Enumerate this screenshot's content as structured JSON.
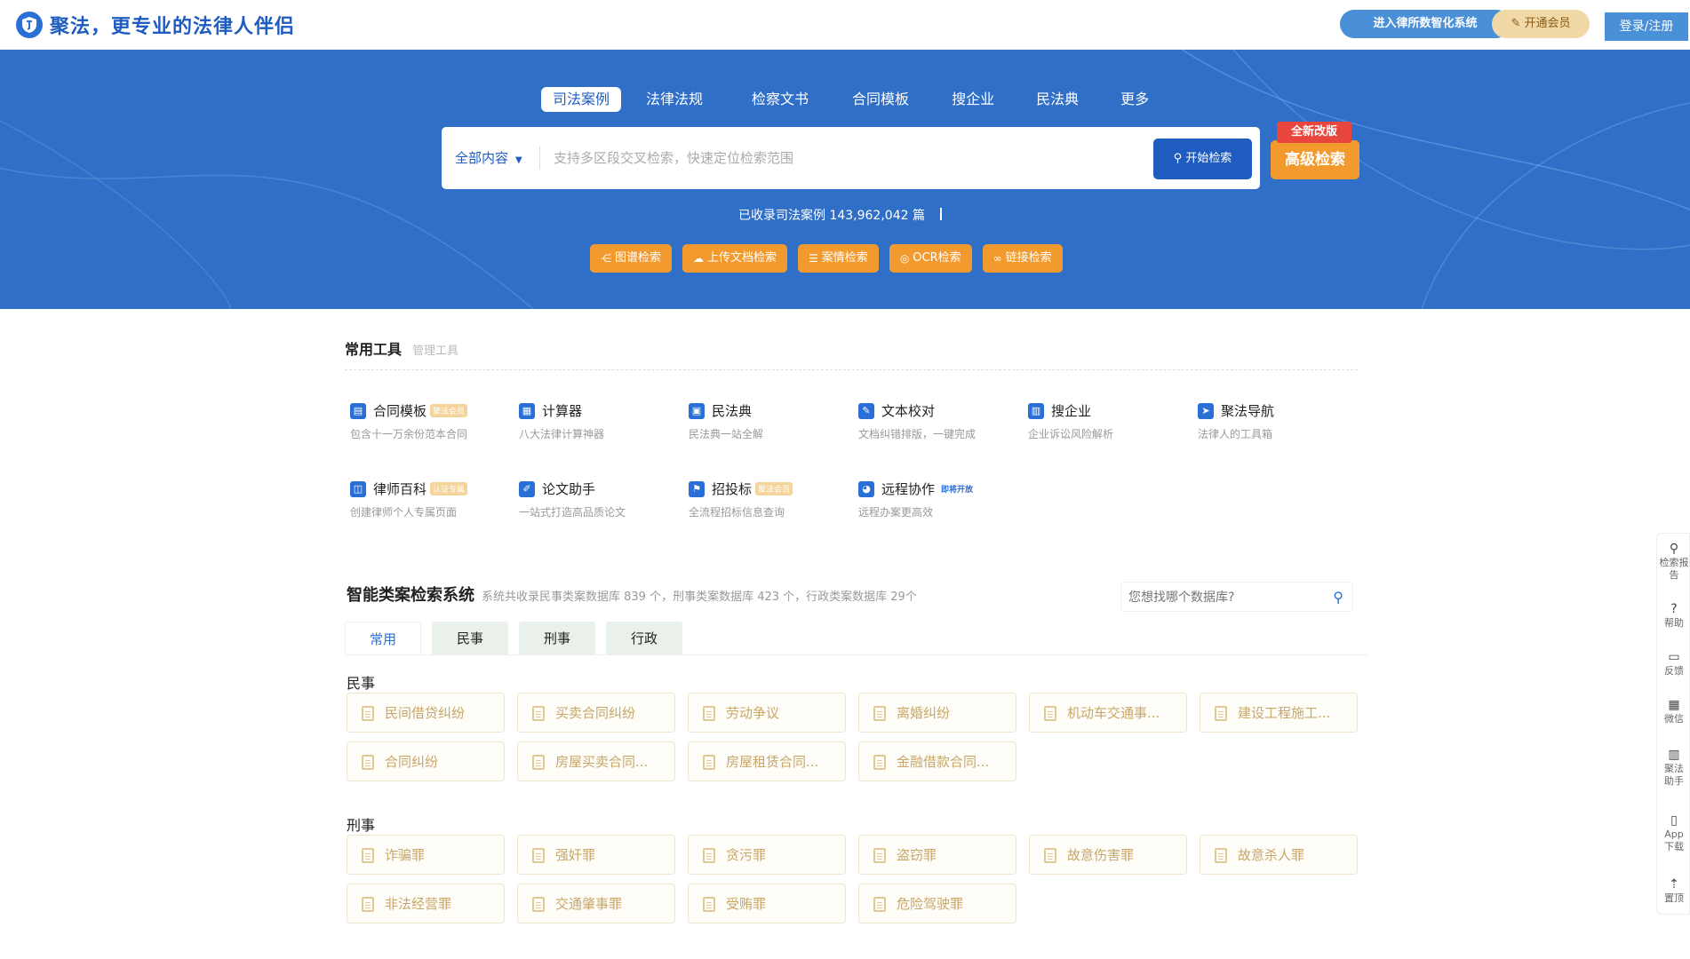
{
  "header": {
    "logo_text": "聚法，更专业的法律人伴侣",
    "firm_button": "进入律所数智化系统",
    "vip_button": "开通会员",
    "login_button": "登录/注册"
  },
  "hero": {
    "tabs": [
      "司法案例",
      "法律法规",
      "检察文书",
      "合同模板",
      "搜企业",
      "民法典",
      "更多"
    ],
    "active_tab": "司法案例",
    "search": {
      "scope": "全部内容",
      "placeholder": "支持多区段交叉检索，快速定位检索范围",
      "button": "开始检索"
    },
    "advanced_button": "高级检索",
    "new_badge": "全新改版",
    "count_text": "已收录司法案例 143,962,042 篇",
    "tool_pills": [
      "图谱检索",
      "上传文档检索",
      "案情检索",
      "OCR检索",
      "链接检索"
    ]
  },
  "common_tools": {
    "title": "常用工具",
    "manage": "管理工具",
    "items": [
      {
        "name": "合同模板",
        "tag": "聚法会员",
        "desc": "包含十一万余份范本合同"
      },
      {
        "name": "计算器",
        "tag": "",
        "desc": "八大法律计算神器"
      },
      {
        "name": "民法典",
        "tag": "",
        "desc": "民法典一站全解"
      },
      {
        "name": "文本校对",
        "tag": "",
        "desc": "文档纠错排版，一键完成"
      },
      {
        "name": "搜企业",
        "tag": "",
        "desc": "企业诉讼风险解析"
      },
      {
        "name": "聚法导航",
        "tag": "",
        "desc": "法律人的工具箱"
      },
      {
        "name": "律师百科",
        "tag": "认证专属",
        "desc": "创建律师个人专属页面"
      },
      {
        "name": "论文助手",
        "tag": "",
        "desc": "一站式打造高品质论文"
      },
      {
        "name": "招投标",
        "tag": "聚法会员",
        "desc": "全流程招标信息查询"
      },
      {
        "name": "远程协作",
        "tag": "即将开放",
        "desc": "远程办案更高效"
      }
    ]
  },
  "smart_search": {
    "title": "智能类案检索系统",
    "subtitle": "系统共收录民事类案数据库 839 个，刑事类案数据库 423 个，行政类案数据库 29个",
    "db_search_placeholder": "您想找哪个数据库?",
    "tabs": [
      "常用",
      "民事",
      "刑事",
      "行政"
    ],
    "active_tab": "常用",
    "civil_label": "民事",
    "civil_items": [
      "民间借贷纠纷",
      "买卖合同纠纷",
      "劳动争议",
      "离婚纠纷",
      "机动车交通事...",
      "建设工程施工...",
      "合同纠纷",
      "房屋买卖合同...",
      "房屋租赁合同...",
      "金融借款合同..."
    ],
    "criminal_label": "刑事",
    "criminal_items": [
      "诈骗罪",
      "强奸罪",
      "贪污罪",
      "盗窃罪",
      "故意伤害罪",
      "故意杀人罪",
      "非法经营罪",
      "交通肇事罪",
      "受贿罪",
      "危险驾驶罪"
    ]
  },
  "sidebar": {
    "items": [
      "检索报告",
      "帮助",
      "反馈",
      "微信",
      "聚法助手",
      "App下载",
      "置顶"
    ]
  },
  "colors": {
    "brand_blue": "#2f6fc8",
    "accent_orange": "#f29a2e",
    "badge_red": "#e8453c"
  }
}
